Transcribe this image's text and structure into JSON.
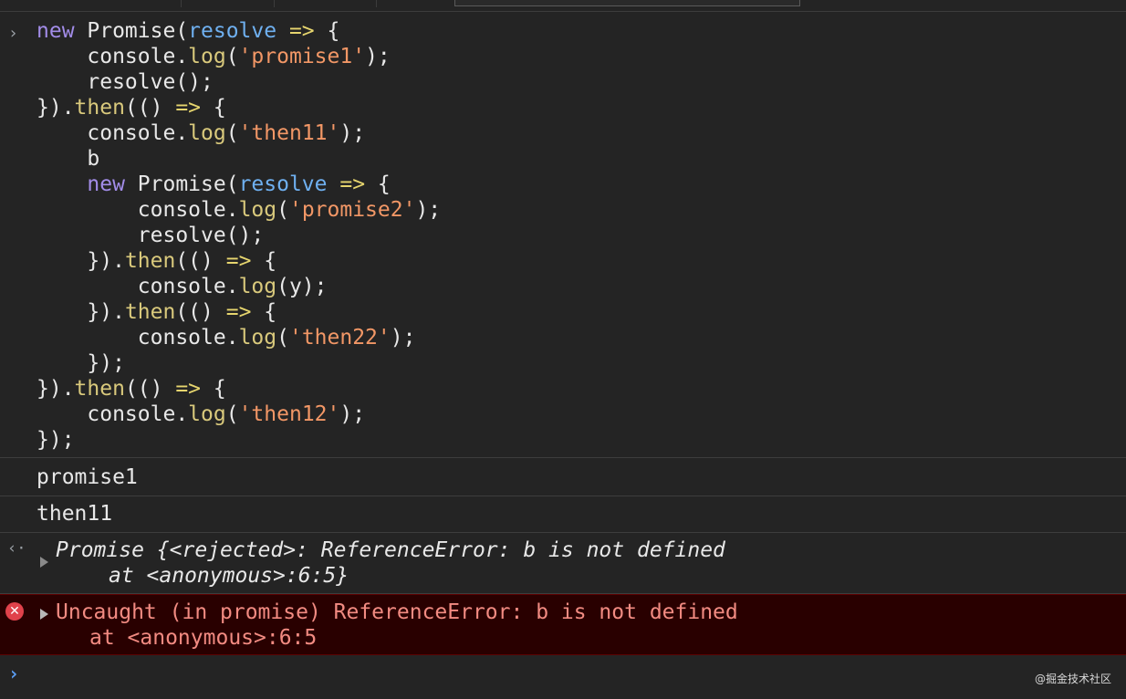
{
  "console": {
    "input": {
      "prompt_symbol": "›",
      "code_lines": [
        [
          {
            "t": "new",
            "c": "kw"
          },
          {
            "t": " Promise(",
            "c": "text"
          },
          {
            "t": "resolve",
            "c": "param"
          },
          {
            "t": " => ",
            "c": "arrow"
          },
          {
            "t": "{",
            "c": "text"
          }
        ],
        [
          {
            "t": "    console.",
            "c": "text"
          },
          {
            "t": "log",
            "c": "fn"
          },
          {
            "t": "(",
            "c": "text"
          },
          {
            "t": "'promise1'",
            "c": "str"
          },
          {
            "t": ");",
            "c": "text"
          }
        ],
        [
          {
            "t": "    resolve();",
            "c": "text"
          }
        ],
        [
          {
            "t": "}).",
            "c": "text"
          },
          {
            "t": "then",
            "c": "fn"
          },
          {
            "t": "(() ",
            "c": "text"
          },
          {
            "t": "=>",
            "c": "arrow"
          },
          {
            "t": " {",
            "c": "text"
          }
        ],
        [
          {
            "t": "    console.",
            "c": "text"
          },
          {
            "t": "log",
            "c": "fn"
          },
          {
            "t": "(",
            "c": "text"
          },
          {
            "t": "'then11'",
            "c": "str"
          },
          {
            "t": ");",
            "c": "text"
          }
        ],
        [
          {
            "t": "    b",
            "c": "text"
          }
        ],
        [
          {
            "t": "    ",
            "c": "text"
          },
          {
            "t": "new",
            "c": "kw"
          },
          {
            "t": " Promise(",
            "c": "text"
          },
          {
            "t": "resolve",
            "c": "param"
          },
          {
            "t": " => ",
            "c": "arrow"
          },
          {
            "t": "{",
            "c": "text"
          }
        ],
        [
          {
            "t": "        console.",
            "c": "text"
          },
          {
            "t": "log",
            "c": "fn"
          },
          {
            "t": "(",
            "c": "text"
          },
          {
            "t": "'promise2'",
            "c": "str"
          },
          {
            "t": ");",
            "c": "text"
          }
        ],
        [
          {
            "t": "        resolve();",
            "c": "text"
          }
        ],
        [
          {
            "t": "    }).",
            "c": "text"
          },
          {
            "t": "then",
            "c": "fn"
          },
          {
            "t": "(() ",
            "c": "text"
          },
          {
            "t": "=>",
            "c": "arrow"
          },
          {
            "t": " {",
            "c": "text"
          }
        ],
        [
          {
            "t": "        console.",
            "c": "text"
          },
          {
            "t": "log",
            "c": "fn"
          },
          {
            "t": "(y);",
            "c": "text"
          }
        ],
        [
          {
            "t": "    }).",
            "c": "text"
          },
          {
            "t": "then",
            "c": "fn"
          },
          {
            "t": "(() ",
            "c": "text"
          },
          {
            "t": "=>",
            "c": "arrow"
          },
          {
            "t": " {",
            "c": "text"
          }
        ],
        [
          {
            "t": "        console.",
            "c": "text"
          },
          {
            "t": "log",
            "c": "fn"
          },
          {
            "t": "(",
            "c": "text"
          },
          {
            "t": "'then22'",
            "c": "str"
          },
          {
            "t": ");",
            "c": "text"
          }
        ],
        [
          {
            "t": "    });",
            "c": "text"
          }
        ],
        [
          {
            "t": "}).",
            "c": "text"
          },
          {
            "t": "then",
            "c": "fn"
          },
          {
            "t": "(() ",
            "c": "text"
          },
          {
            "t": "=>",
            "c": "arrow"
          },
          {
            "t": " {",
            "c": "text"
          }
        ],
        [
          {
            "t": "    console.",
            "c": "text"
          },
          {
            "t": "log",
            "c": "fn"
          },
          {
            "t": "(",
            "c": "text"
          },
          {
            "t": "'then12'",
            "c": "str"
          },
          {
            "t": ");",
            "c": "text"
          }
        ],
        [
          {
            "t": "});",
            "c": "text"
          }
        ]
      ]
    },
    "logs": [
      "promise1",
      "then11"
    ],
    "result": {
      "icon": "return-value-icon",
      "line1": "Promise {<rejected>: ReferenceError: b is not defined",
      "line2": "at <anonymous>:6:5}"
    },
    "error": {
      "icon": "error-icon",
      "icon_glyph": "✕",
      "line1": "Uncaught (in promise) ReferenceError: b is not defined",
      "line2": "at <anonymous>:6:5"
    },
    "prompt": {
      "symbol": "›"
    }
  },
  "watermark": "@掘金技术社区",
  "colors": {
    "background": "#242424",
    "keyword": "#a28ce8",
    "param": "#6fb0f0",
    "arrow": "#e6d56e",
    "function": "#d9c97c",
    "string": "#f29766",
    "error_text": "#f28b82",
    "error_bg": "#290000",
    "error_icon": "#e0424b",
    "prompt": "#5b9ef5"
  }
}
